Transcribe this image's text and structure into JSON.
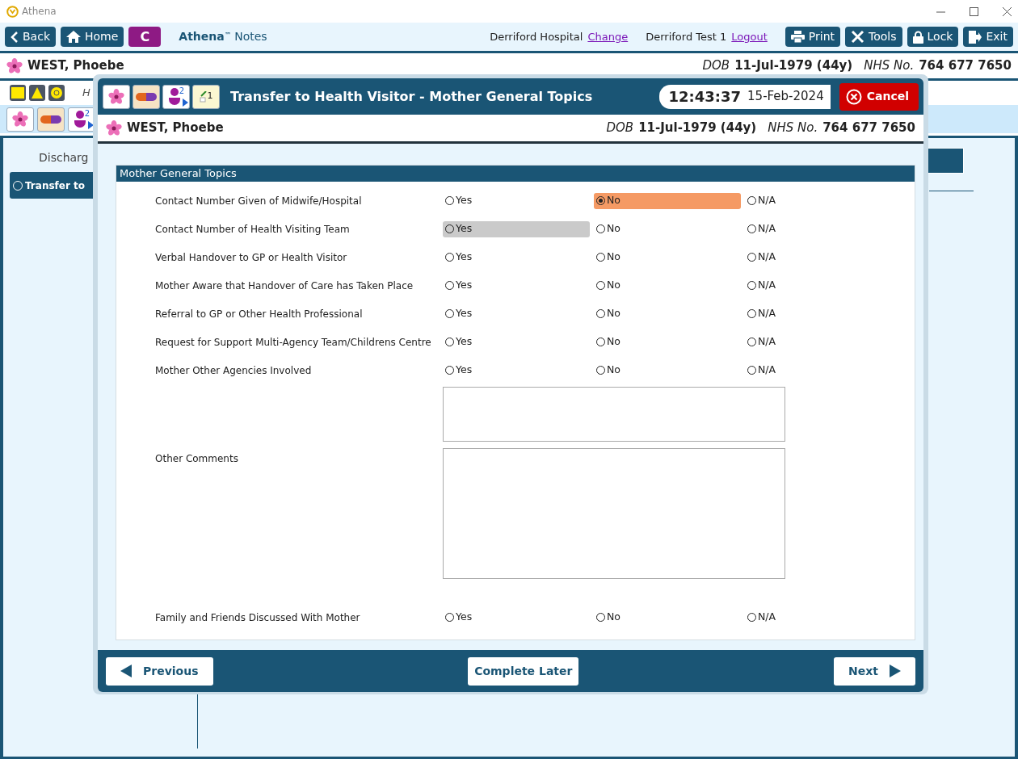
{
  "window": {
    "title": "Athena"
  },
  "toolbar": {
    "left_buttons": [
      "Back",
      "Home"
    ],
    "c_button": "C",
    "brand": "Athena",
    "brand_mark": "™",
    "brand_sub": "Notes",
    "hospital": "Derriford Hospital",
    "change_link": "Change",
    "user": "Derriford Test 1",
    "logout_link": "Logout",
    "right_buttons": [
      "Print",
      "Tools",
      "Lock",
      "Exit"
    ]
  },
  "patient": {
    "name": "WEST, Phoebe",
    "dob_label": "DOB",
    "dob": "11-Jul-1979 (44y)",
    "nhs_label": "NHS No.",
    "nhs": "764 677 7650"
  },
  "background": {
    "person_count": "2",
    "hint": "H",
    "section": "Discharg",
    "step_button": "Transfer to"
  },
  "dialog": {
    "note_count": "1",
    "person_count": "2",
    "title": "Transfer to Health Visitor - Mother General Topics",
    "time": "12:43:37",
    "date": "15-Feb-2024",
    "cancel": "Cancel",
    "patient": {
      "name": "WEST, Phoebe",
      "dob_label": "DOB",
      "dob": "11-Jul-1979 (44y)",
      "nhs_label": "NHS No.",
      "nhs": "764 677 7650"
    },
    "section_title": "Mother General Topics",
    "items": [
      {
        "kind": "radio",
        "label": "Contact Number Given of Midwife/Hospital",
        "options": [
          {
            "label": "Yes",
            "selected": false,
            "hovered": false
          },
          {
            "label": "No",
            "selected": true,
            "hovered": false
          },
          {
            "label": "N/A",
            "selected": false,
            "hovered": false
          }
        ]
      },
      {
        "kind": "radio",
        "label": "Contact Number of Health Visiting Team",
        "options": [
          {
            "label": "Yes",
            "selected": false,
            "hovered": true
          },
          {
            "label": "No",
            "selected": false,
            "hovered": false
          },
          {
            "label": "N/A",
            "selected": false,
            "hovered": false
          }
        ]
      },
      {
        "kind": "radio",
        "label": "Verbal Handover to GP or Health Visitor",
        "options": [
          {
            "label": "Yes",
            "selected": false,
            "hovered": false
          },
          {
            "label": "No",
            "selected": false,
            "hovered": false
          },
          {
            "label": "N/A",
            "selected": false,
            "hovered": false
          }
        ]
      },
      {
        "kind": "radio",
        "label": "Mother Aware that Handover of Care has Taken Place",
        "options": [
          {
            "label": "Yes",
            "selected": false,
            "hovered": false
          },
          {
            "label": "No",
            "selected": false,
            "hovered": false
          },
          {
            "label": "N/A",
            "selected": false,
            "hovered": false
          }
        ]
      },
      {
        "kind": "radio",
        "label": "Referral to GP or Other Health Professional",
        "options": [
          {
            "label": "Yes",
            "selected": false,
            "hovered": false
          },
          {
            "label": "No",
            "selected": false,
            "hovered": false
          },
          {
            "label": "N/A",
            "selected": false,
            "hovered": false
          }
        ]
      },
      {
        "kind": "radio",
        "label": "Request for Support Multi-Agency Team/Childrens Centre",
        "options": [
          {
            "label": "Yes",
            "selected": false,
            "hovered": false
          },
          {
            "label": "No",
            "selected": false,
            "hovered": false
          },
          {
            "label": "N/A",
            "selected": false,
            "hovered": false
          }
        ]
      },
      {
        "kind": "radio",
        "label": "Mother Other Agencies Involved",
        "options": [
          {
            "label": "Yes",
            "selected": false,
            "hovered": false
          },
          {
            "label": "No",
            "selected": false,
            "hovered": false
          },
          {
            "label": "N/A",
            "selected": false,
            "hovered": false
          }
        ]
      },
      {
        "kind": "textarea"
      },
      {
        "kind": "textarea",
        "label": "Other Comments"
      },
      {
        "kind": "radio",
        "label": "Family and Friends Discussed With Mother",
        "options": [
          {
            "label": "Yes",
            "selected": false,
            "hovered": false
          },
          {
            "label": "No",
            "selected": false,
            "hovered": false
          },
          {
            "label": "N/A",
            "selected": false,
            "hovered": false
          }
        ]
      }
    ],
    "footer": {
      "previous": "Previous",
      "complete_later": "Complete Later",
      "next": "Next"
    }
  }
}
